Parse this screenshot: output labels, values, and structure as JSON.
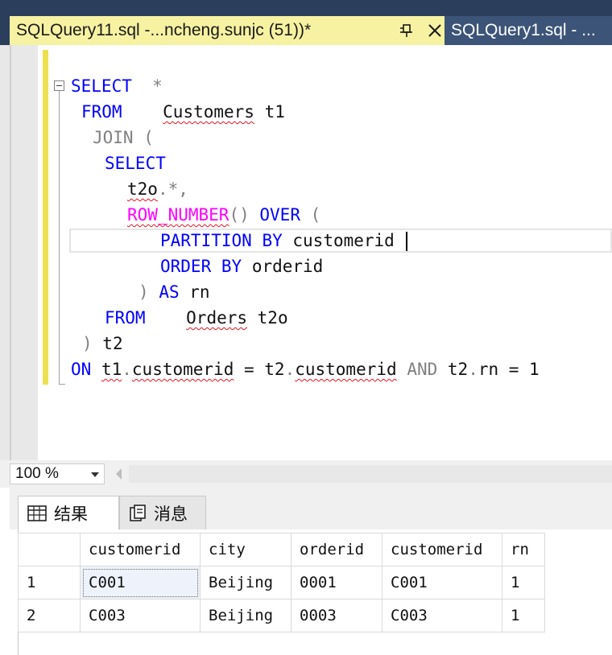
{
  "document_tabs": [
    {
      "title": "SQLQuery11.sql -...ncheng.sunjc (51))*",
      "active": true
    },
    {
      "title": "SQLQuery1.sql - ...",
      "active": false
    }
  ],
  "editor": {
    "lines": [
      {
        "tokens": [
          {
            "t": "SELECT",
            "c": "kw"
          },
          {
            "t": "  *",
            "c": "gray"
          }
        ]
      },
      {
        "tokens": [
          {
            "t": "FROM",
            "c": "kw"
          },
          {
            "t": "    "
          },
          {
            "t": "Customers",
            "c": "sq"
          },
          {
            "t": " t1"
          }
        ]
      },
      {
        "tokens": [
          {
            "t": "JOIN",
            "c": "gray"
          },
          {
            "t": " (",
            "c": "gray"
          }
        ]
      },
      {
        "tokens": [
          {
            "t": "SELECT",
            "c": "kw"
          }
        ]
      },
      {
        "tokens": [
          {
            "t": "t2o",
            "c": "sq"
          },
          {
            "t": ".*,",
            "c": "gray"
          }
        ]
      },
      {
        "tokens": [
          {
            "t": "ROW_NUMBER",
            "c": "fn sq"
          },
          {
            "t": "()",
            "c": "gray"
          },
          {
            "t": " "
          },
          {
            "t": "OVER",
            "c": "kw"
          },
          {
            "t": " (",
            "c": "gray"
          }
        ]
      },
      {
        "tokens": [
          {
            "t": "PARTITION",
            "c": "kw"
          },
          {
            "t": " "
          },
          {
            "t": "BY",
            "c": "kw"
          },
          {
            "t": " customerid "
          }
        ]
      },
      {
        "tokens": [
          {
            "t": "ORDER",
            "c": "kw"
          },
          {
            "t": " "
          },
          {
            "t": "BY",
            "c": "kw"
          },
          {
            "t": " orderid"
          }
        ]
      },
      {
        "tokens": [
          {
            "t": ")",
            "c": "gray"
          },
          {
            "t": " "
          },
          {
            "t": "AS",
            "c": "kw"
          },
          {
            "t": " rn"
          }
        ]
      },
      {
        "tokens": [
          {
            "t": "FROM",
            "c": "kw"
          },
          {
            "t": "    "
          },
          {
            "t": "Orders",
            "c": "sq"
          },
          {
            "t": " t2o"
          }
        ]
      },
      {
        "tokens": [
          {
            "t": ")",
            "c": "gray"
          },
          {
            "t": " t2"
          }
        ]
      },
      {
        "tokens": [
          {
            "t": "ON",
            "c": "kw"
          },
          {
            "t": " "
          },
          {
            "t": "t1",
            "c": "sq"
          },
          {
            "t": ".",
            "c": "gray"
          },
          {
            "t": "customerid",
            "c": "sq"
          },
          {
            "t": " = t2"
          },
          {
            "t": ".",
            "c": "gray"
          },
          {
            "t": "customerid",
            "c": "sq"
          },
          {
            "t": " "
          },
          {
            "t": "AND",
            "c": "gray"
          },
          {
            "t": " t2"
          },
          {
            "t": ".",
            "c": "gray"
          },
          {
            "t": "rn = 1"
          }
        ]
      }
    ]
  },
  "zoom": {
    "value": "100 %"
  },
  "results_tabs": [
    {
      "label": "结果",
      "icon": "grid-icon",
      "active": true
    },
    {
      "label": "消息",
      "icon": "messages-icon",
      "active": false
    }
  ],
  "results_grid": {
    "columns": [
      "customerid",
      "city",
      "orderid",
      "customerid",
      "rn"
    ],
    "rows": [
      {
        "num": "1",
        "cells": [
          "C001",
          "Beijing",
          "0001",
          "C001",
          "1"
        ]
      },
      {
        "num": "2",
        "cells": [
          "C003",
          "Beijing",
          "0003",
          "C003",
          "1"
        ]
      }
    ]
  },
  "colors": {
    "keyword": "#0000ff",
    "function": "#ff00ff",
    "operator": "#808080",
    "squiggle": "#e81123",
    "active_tab": "#f6f2a2",
    "tab_strip": "#2b3e5c"
  }
}
